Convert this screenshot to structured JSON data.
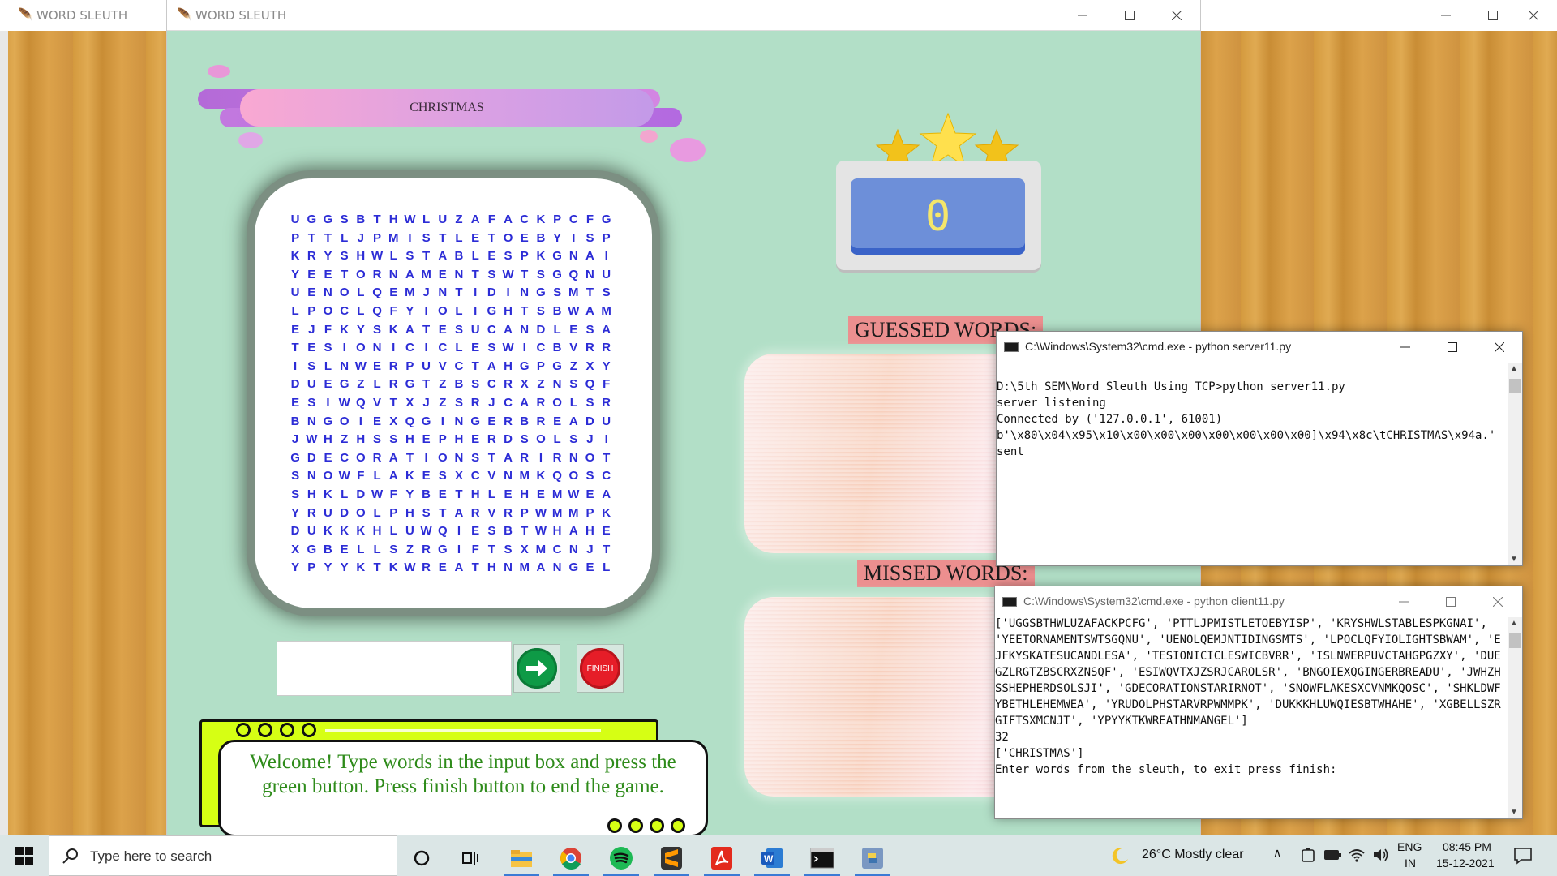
{
  "back_window": {
    "title": "WORD SLEUTH"
  },
  "game_window": {
    "title": "WORD SLEUTH"
  },
  "category": "CHRISTMAS",
  "grid": [
    "UGGSBTHWLUZAFACKPCFG",
    "PTTLJPMISTLETOEBYISP",
    "KRYSHWLSTABLESPKGNAI",
    "YEETORNAMENTSWTSGQNU",
    "UENOLQEMJNTIDINGSMTS",
    "LPOCLQFYIOLIGHTSBWAM",
    "EJFKYSKATESUCANDLESA",
    "TESIONICICLESWICBVRR",
    "ISLNWERPUVCTAHGPGZXY",
    "DUEGZLRGTZBSCRXZNSQF",
    "ESIWQVTXJZSRJCAROLSR",
    "BNGOIEXQGINGERBREADU",
    "JWHZHSSHEPHERDSOLSJI",
    "GDECORATIONSTARIRNOT",
    "SNOWFLAKESXCVNMKQOSC",
    "SHKLDWFYBETHLEHEMWEA",
    "YRUDOLPHSTARVRPWMMPK",
    "DUKKKHLUWQIESBTWHAHE",
    "XGBELLSZRGIFTSXMCNJT",
    "YPYYKTKWREATHNMANGEL"
  ],
  "input": {
    "value": "",
    "placeholder": ""
  },
  "finish_label": "FINISH",
  "message": "Welcome! Type words in the input box and press the green button. Press finish button to end the game.",
  "score": "0",
  "guessed_label": "GUESSED WORDS:",
  "missed_label": "MISSED WORDS:",
  "server_console": {
    "title": "C:\\Windows\\System32\\cmd.exe - python  server11.py",
    "text": "\nD:\\5th SEM\\Word Sleuth Using TCP>python server11.py\nserver listening\nConnected by ('127.0.0.1', 61001)\nb'\\x80\\x04\\x95\\x10\\x00\\x00\\x00\\x00\\x00\\x00\\x00]\\x94\\x8c\\tCHRISTMAS\\x94a.'\nsent\n_"
  },
  "client_console": {
    "title": "C:\\Windows\\System32\\cmd.exe - python  client11.py",
    "text": "['UGGSBTHWLUZAFACKPCFG', 'PTTLJPMISTLETOEBYISP', 'KRYSHWLSTABLESPKGNAI', 'YEETORNAMENTSWTSGQNU', 'UENOLQEMJNTIDINGSMTS', 'LPOCLQFYIOLIGHTSBWAM', 'EJFKYSKATESUCANDLESA', 'TESIONICICLESWICBVRR', 'ISLNWERPUVCTAHGPGZXY', 'DUEGZLRGTZBSCRXZNSQF', 'ESIWQVTXJZSRJCAROLSR', 'BNGOIEXQGINGERBREADU', 'JWHZHSSHEPHERDSOLSJI', 'GDECORATIONSTARIRNOT', 'SNOWFLAKESXCVNMKQOSC', 'SHKLDWFYBETHLEHEMWEA', 'YRUDOLPHSTARVRPWMMPK', 'DUKKKHLUWQIESBTWHAHE', 'XGBELLSZRGIFTSXMCNJT', 'YPYYKTKWREATHNMANGEL']\n32\n['CHRISTMAS']\nEnter words from the sleuth, to exit press finish:"
  },
  "taskbar": {
    "search_placeholder": "Type here to search",
    "weather": "26°C  Mostly clear",
    "lang_top": "ENG",
    "lang_bottom": "IN",
    "time": "08:45 PM",
    "date": "15-12-2021",
    "apps": [
      "cortana-icon",
      "task-view-icon",
      "file-explorer-icon",
      "chrome-icon",
      "spotify-icon",
      "sublime-text-icon",
      "acrobat-icon",
      "word-icon",
      "cmd-icon",
      "python-icon"
    ]
  },
  "colors": {
    "grid_letter": "#2c2cd6",
    "game_bg": "#b2dfc7",
    "message_text": "#2e8b1a",
    "label_bg": "#ec8f8f"
  }
}
